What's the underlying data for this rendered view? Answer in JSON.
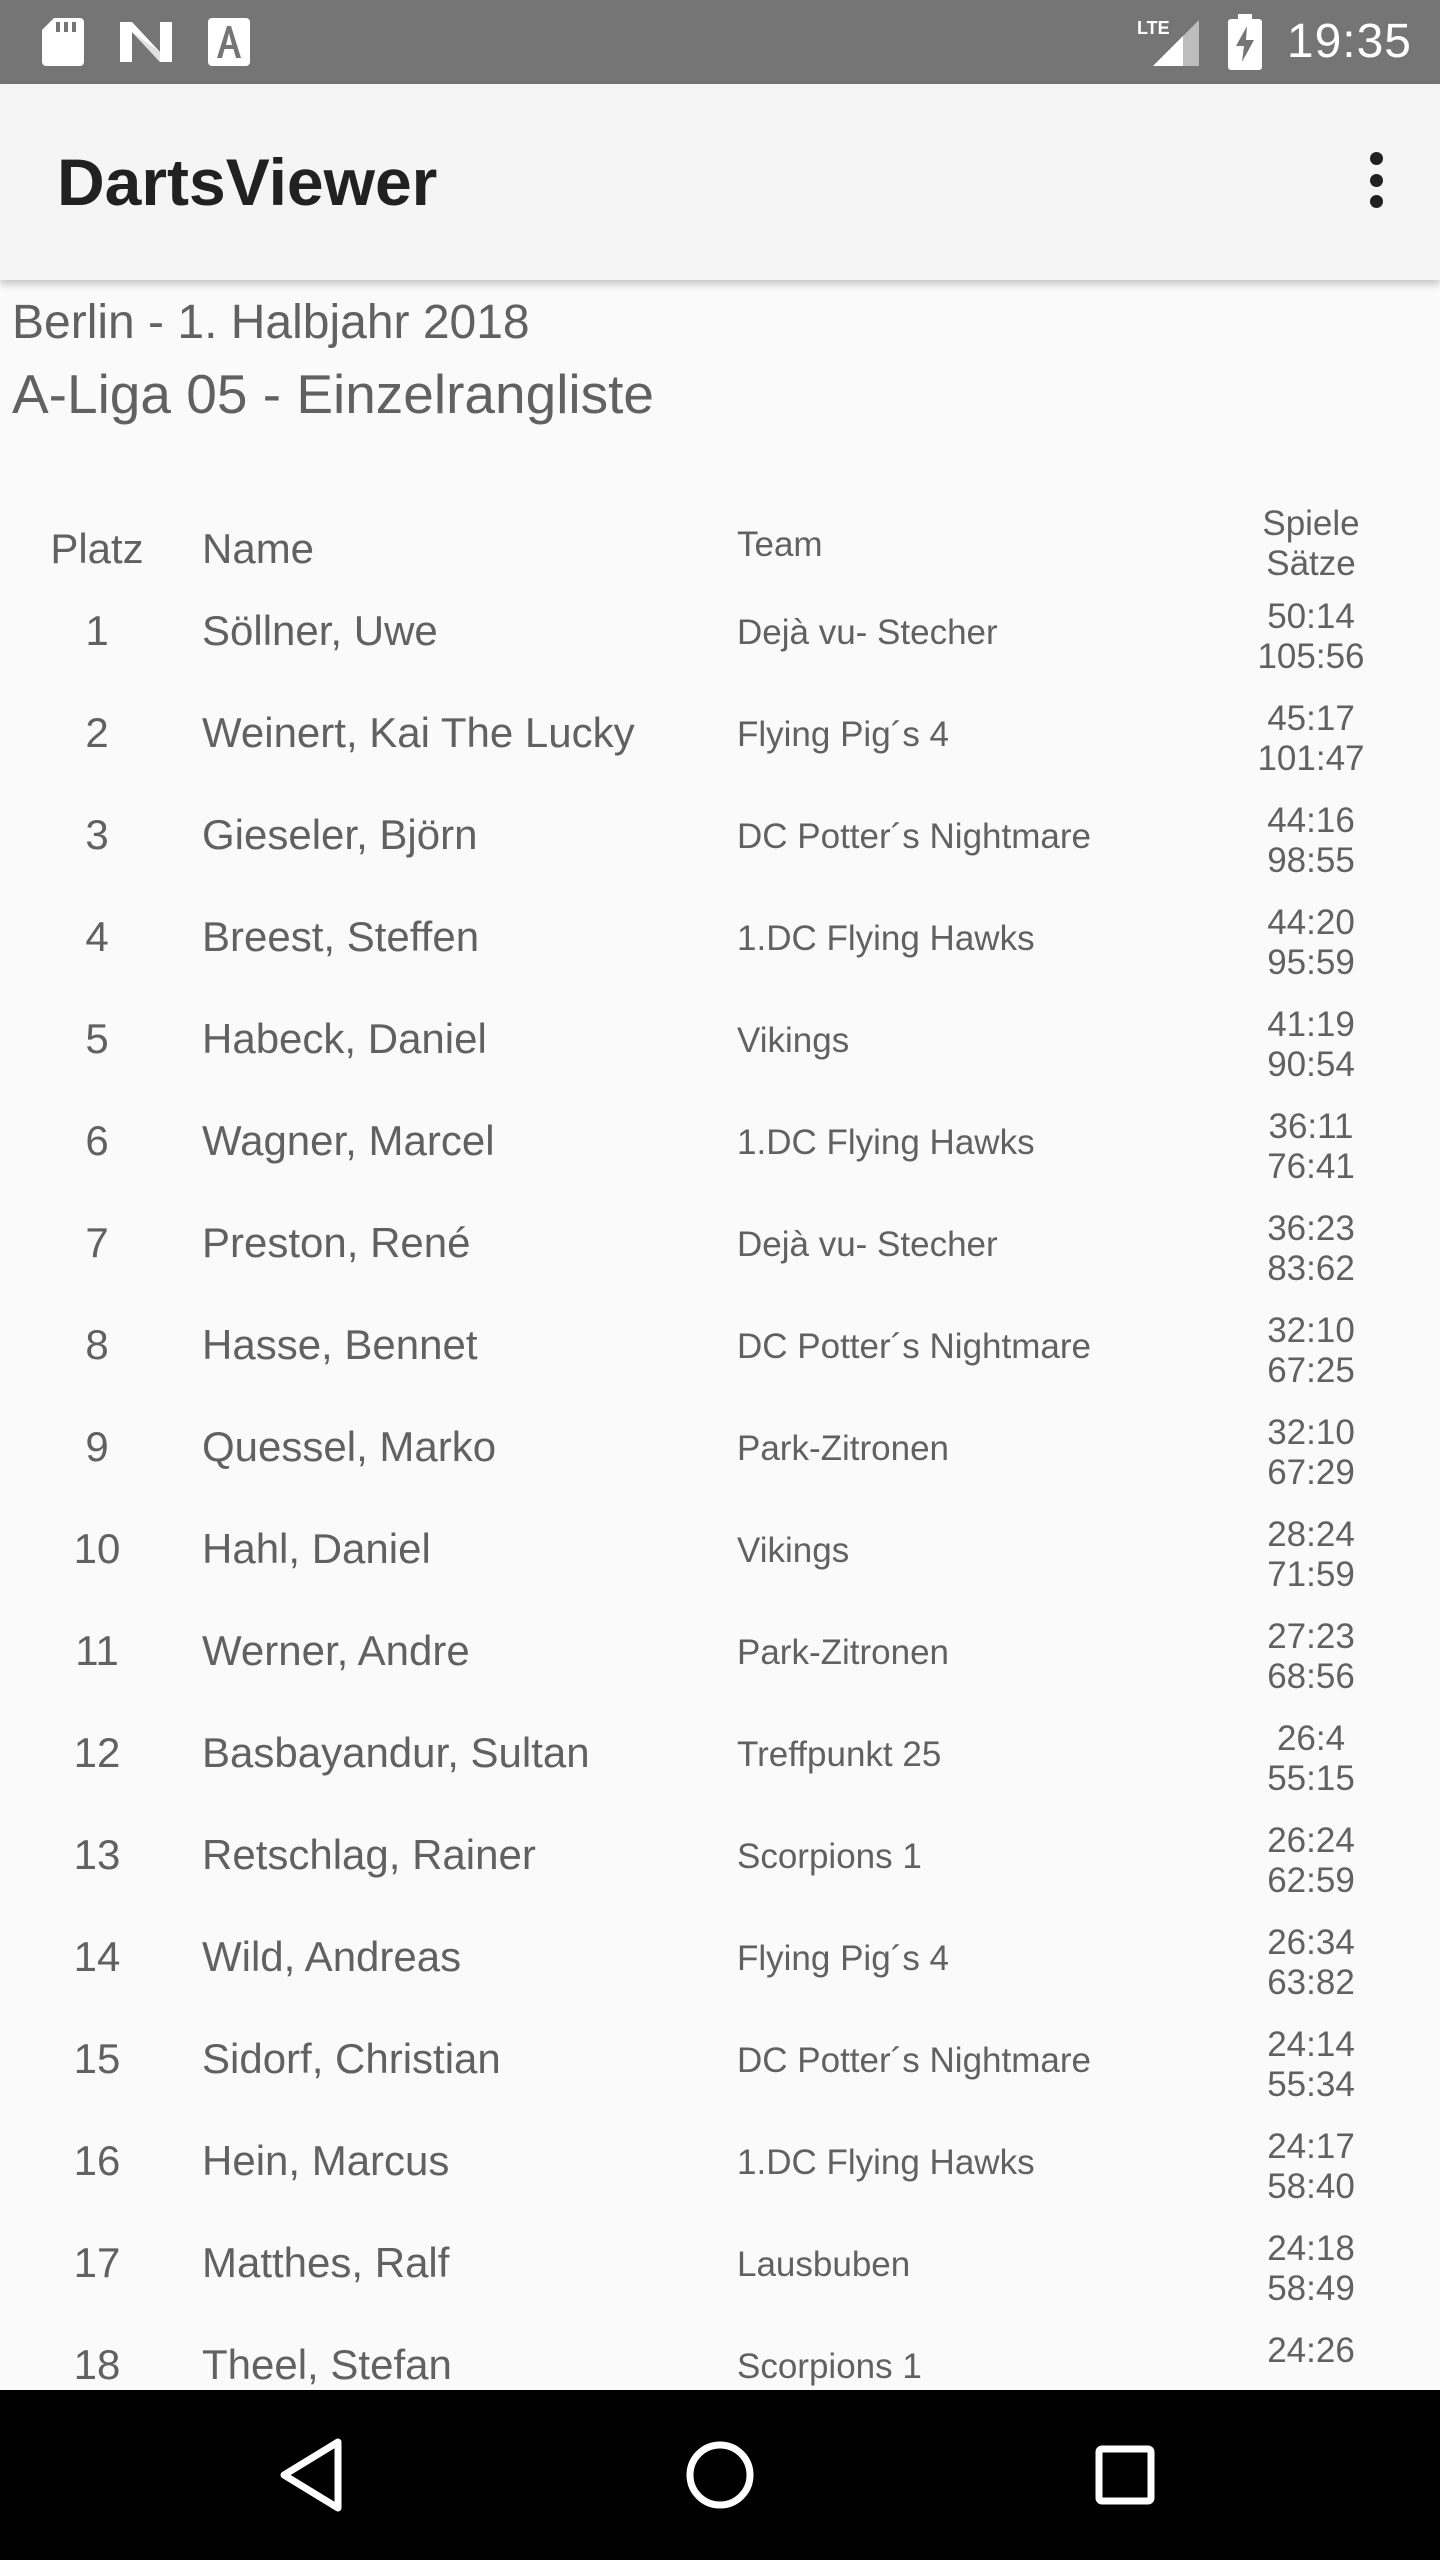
{
  "status_bar": {
    "time": "19:35",
    "network": "LTE",
    "icons": [
      "sd-card-icon",
      "n-logo-icon",
      "font-a-icon",
      "signal-icon",
      "battery-charging-icon"
    ]
  },
  "app_bar": {
    "title": "DartsViewer",
    "menu_icon": "more-vert-icon"
  },
  "header": {
    "subtitle": "Berlin - 1. Halbjahr 2018",
    "title": "A-Liga 05 - Einzelrangliste"
  },
  "table": {
    "columns": {
      "place": "Platz",
      "name": "Name",
      "team": "Team",
      "stats_line1": "Spiele",
      "stats_line2": "Sätze"
    },
    "rows": [
      {
        "place": "1",
        "name": "Söllner, Uwe",
        "team": "Dejà vu- Stecher",
        "games": "50:14",
        "sets": "105:56"
      },
      {
        "place": "2",
        "name": "Weinert, Kai The Lucky",
        "team": "Flying Pig´s 4",
        "games": "45:17",
        "sets": "101:47"
      },
      {
        "place": "3",
        "name": "Gieseler, Björn",
        "team": "DC Potter´s Nightmare",
        "games": "44:16",
        "sets": "98:55"
      },
      {
        "place": "4",
        "name": "Breest, Steffen",
        "team": "1.DC Flying Hawks",
        "games": "44:20",
        "sets": "95:59"
      },
      {
        "place": "5",
        "name": "Habeck, Daniel",
        "team": "Vikings",
        "games": "41:19",
        "sets": "90:54"
      },
      {
        "place": "6",
        "name": "Wagner, Marcel",
        "team": "1.DC Flying Hawks",
        "games": "36:11",
        "sets": "76:41"
      },
      {
        "place": "7",
        "name": "Preston, René",
        "team": "Dejà vu- Stecher",
        "games": "36:23",
        "sets": "83:62"
      },
      {
        "place": "8",
        "name": "Hasse, Bennet",
        "team": "DC Potter´s Nightmare",
        "games": "32:10",
        "sets": "67:25"
      },
      {
        "place": "9",
        "name": "Quessel, Marko",
        "team": "Park-Zitronen",
        "games": "32:10",
        "sets": "67:29"
      },
      {
        "place": "10",
        "name": "Hahl, Daniel",
        "team": "Vikings",
        "games": "28:24",
        "sets": "71:59"
      },
      {
        "place": "11",
        "name": "Werner, Andre",
        "team": "Park-Zitronen",
        "games": "27:23",
        "sets": "68:56"
      },
      {
        "place": "12",
        "name": "Basbayandur, Sultan",
        "team": "Treffpunkt 25",
        "games": "26:4",
        "sets": "55:15"
      },
      {
        "place": "13",
        "name": "Retschlag, Rainer",
        "team": "Scorpions 1",
        "games": "26:24",
        "sets": "62:59"
      },
      {
        "place": "14",
        "name": "Wild, Andreas",
        "team": "Flying Pig´s 4",
        "games": "26:34",
        "sets": "63:82"
      },
      {
        "place": "15",
        "name": "Sidorf, Christian",
        "team": "DC Potter´s Nightmare",
        "games": "24:14",
        "sets": "55:34"
      },
      {
        "place": "16",
        "name": "Hein, Marcus",
        "team": "1.DC Flying Hawks",
        "games": "24:17",
        "sets": "58:40"
      },
      {
        "place": "17",
        "name": "Matthes, Ralf",
        "team": "Lausbuben",
        "games": "24:18",
        "sets": "58:49"
      },
      {
        "place": "18",
        "name": "Theel, Stefan",
        "team": "Scorpions 1",
        "games": "24:26",
        "sets": ""
      }
    ]
  },
  "nav_bar": {
    "buttons": [
      "back-icon",
      "home-icon",
      "recents-icon"
    ]
  },
  "colors": {
    "status_bar": "#757575",
    "app_bar": "#f5f5f5",
    "background": "#fafafa",
    "text_primary": "#212121",
    "text_secondary": "#616161",
    "nav_bar": "#000000"
  }
}
